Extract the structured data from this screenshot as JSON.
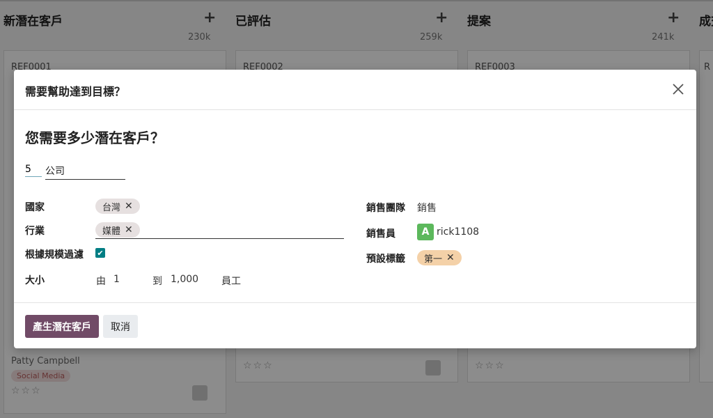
{
  "kanban": {
    "columns": [
      {
        "title": "新潛在客戶",
        "total": "230k",
        "card_ref": "REF0001"
      },
      {
        "title": "已評估",
        "total": "259k",
        "card_ref": "REF0002"
      },
      {
        "title": "提案",
        "total": "241k",
        "card_ref": "REF0003"
      },
      {
        "title": "成交",
        "total": "",
        "card_ref": "R"
      }
    ],
    "bg_contact": "Patty Campbell",
    "bg_badge": "Social Media"
  },
  "modal": {
    "title": "需要幫助達到目標？",
    "question": "您需要多少潛在客戶？",
    "count_value": "5",
    "lead_type": "公司",
    "left_fields": {
      "country_label": "國家",
      "country_tag": "台灣",
      "industry_label": "行業",
      "industry_tag": "媒體",
      "filter_label": "根據規模過濾",
      "size_label": "大小",
      "size_from_label": "由",
      "size_from": "1",
      "size_to_label": "到",
      "size_to": "1,000",
      "size_unit": "員工"
    },
    "right_fields": {
      "team_label": "銷售團隊",
      "team_value": "銷售",
      "salesperson_label": "銷售員",
      "salesperson_avatar": "A",
      "salesperson_value": "rick1108",
      "tag_label": "預設標籤",
      "tag_value": "第一"
    },
    "generate_button": "產生潛在客戶",
    "cancel_button": "取消"
  },
  "colors": {
    "primary": "#714b67",
    "checkbox": "#017e84",
    "avatar": "#5cb85c",
    "tag_orange": "#f4d1a8"
  }
}
